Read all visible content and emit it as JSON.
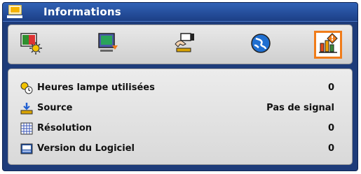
{
  "window": {
    "title": "Informations",
    "title_icon": "monitor-settings-icon"
  },
  "tabs": [
    {
      "icon": "image-settings-icon",
      "selected": false
    },
    {
      "icon": "display-settings-icon",
      "selected": false
    },
    {
      "icon": "setup-hand-icon",
      "selected": false
    },
    {
      "icon": "globe-options-icon",
      "selected": false
    },
    {
      "icon": "information-chart-icon",
      "selected": true
    }
  ],
  "info": {
    "rows": [
      {
        "label": "Heures lampe utilisées",
        "value": "0",
        "icon": "lamp-hours-icon"
      },
      {
        "label": "Source",
        "value": "Pas de signal",
        "icon": "source-icon"
      },
      {
        "label": "Résolution",
        "value": "0",
        "icon": "resolution-icon"
      },
      {
        "label": "Version du Logiciel",
        "value": "0",
        "icon": "software-version-icon"
      }
    ]
  },
  "colors": {
    "frame": "#1e3c7a",
    "titlebar": "#2a55a6",
    "selection": "#f07c1a",
    "panel": "#e2e2e2"
  }
}
